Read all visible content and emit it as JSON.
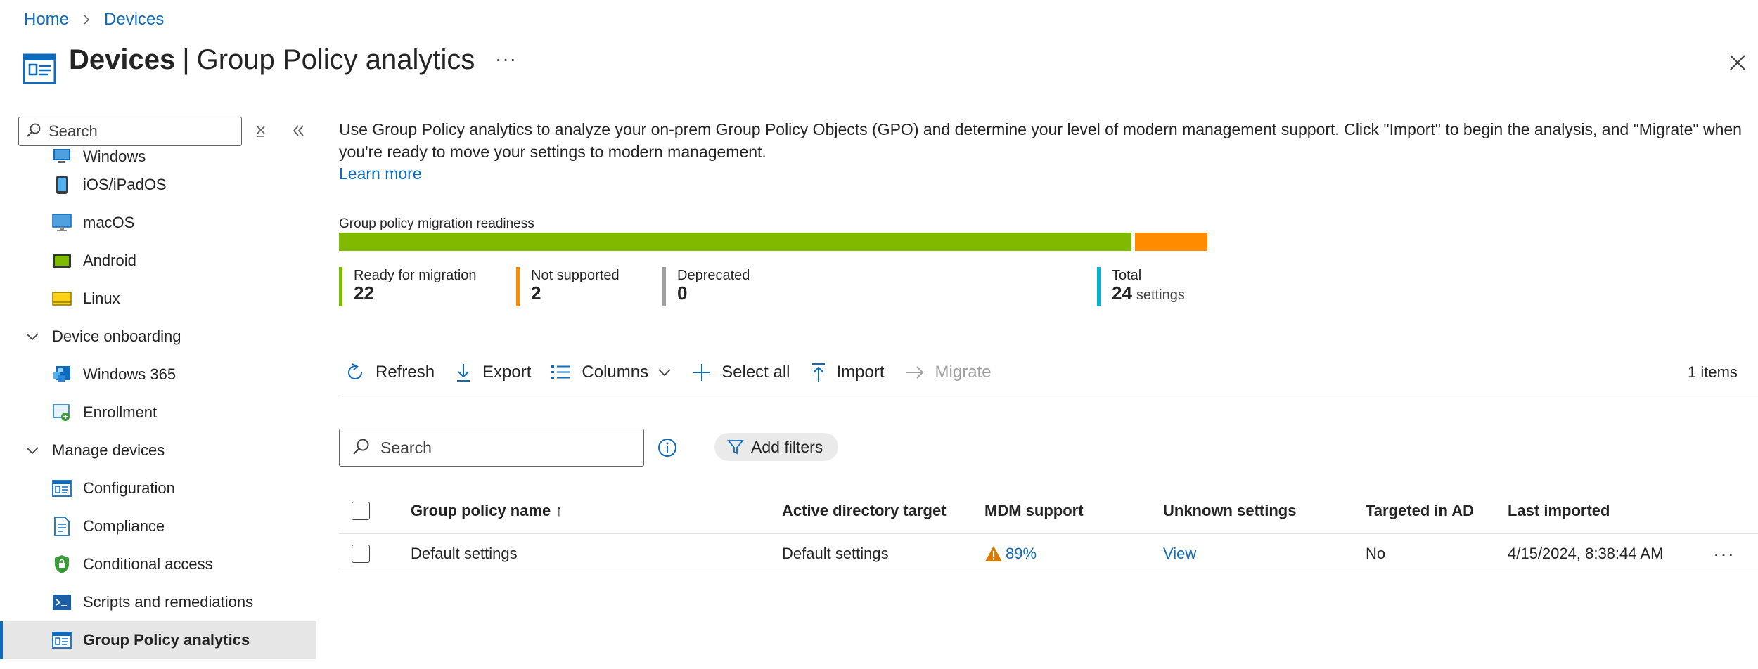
{
  "breadcrumb": {
    "home": "Home",
    "devices": "Devices"
  },
  "header": {
    "title_main": "Devices",
    "title_sep": "|",
    "title_sub": "Group Policy analytics",
    "more": "···"
  },
  "sidebar": {
    "search_placeholder": "Search",
    "items": [
      {
        "label": "Windows",
        "icon": "windows-device-icon"
      },
      {
        "label": "iOS/iPadOS",
        "icon": "phone-icon"
      },
      {
        "label": "macOS",
        "icon": "monitor-icon"
      },
      {
        "label": "Android",
        "icon": "android-device-icon"
      },
      {
        "label": "Linux",
        "icon": "linux-device-icon"
      },
      {
        "label": "Device onboarding",
        "group": true
      },
      {
        "label": "Windows 365",
        "icon": "windows365-icon"
      },
      {
        "label": "Enrollment",
        "icon": "enrollment-icon"
      },
      {
        "label": "Manage devices",
        "group": true
      },
      {
        "label": "Configuration",
        "icon": "configuration-icon"
      },
      {
        "label": "Compliance",
        "icon": "compliance-icon"
      },
      {
        "label": "Conditional access",
        "icon": "conditional-access-icon"
      },
      {
        "label": "Scripts and remediations",
        "icon": "scripts-icon"
      },
      {
        "label": "Group Policy analytics",
        "icon": "group-policy-icon",
        "selected": true
      }
    ]
  },
  "main": {
    "description": "Use Group Policy analytics to analyze your on-prem Group Policy Objects (GPO) and determine your level of modern management support. Click \"Import\" to begin the analysis, and \"Migrate\" when you're ready to move your settings to modern management.",
    "learn_more": "Learn more",
    "readiness": {
      "title": "Group policy migration readiness",
      "ready": {
        "label": "Ready for migration",
        "value": "22",
        "color": "#7fba00"
      },
      "not_supported": {
        "label": "Not supported",
        "value": "2",
        "color": "#ff8c00"
      },
      "deprecated": {
        "label": "Deprecated",
        "value": "0",
        "color": "#a0a0a0"
      },
      "total": {
        "label": "Total",
        "value": "24",
        "unit": "settings",
        "color": "#00b4d8"
      }
    },
    "toolbar": {
      "refresh": "Refresh",
      "export": "Export",
      "columns": "Columns",
      "select_all": "Select all",
      "import": "Import",
      "migrate": "Migrate",
      "items_count": "1 items"
    },
    "search_placeholder": "Search",
    "add_filters": "Add filters",
    "table": {
      "headers": {
        "name": "Group policy name ↑",
        "ad_target": "Active directory target",
        "mdm": "MDM support",
        "unknown": "Unknown settings",
        "targeted": "Targeted in AD",
        "imported": "Last imported"
      },
      "rows": [
        {
          "name": "Default settings",
          "ad_target": "Default settings",
          "mdm": "89%",
          "unknown": "View",
          "targeted": "No",
          "imported": "4/15/2024, 8:38:44 AM",
          "more": "···"
        }
      ]
    }
  },
  "colors": {
    "accent": "#0f6cbd",
    "ready": "#7fba00",
    "unsupported": "#ff8c00",
    "warning": "#da7b00"
  }
}
